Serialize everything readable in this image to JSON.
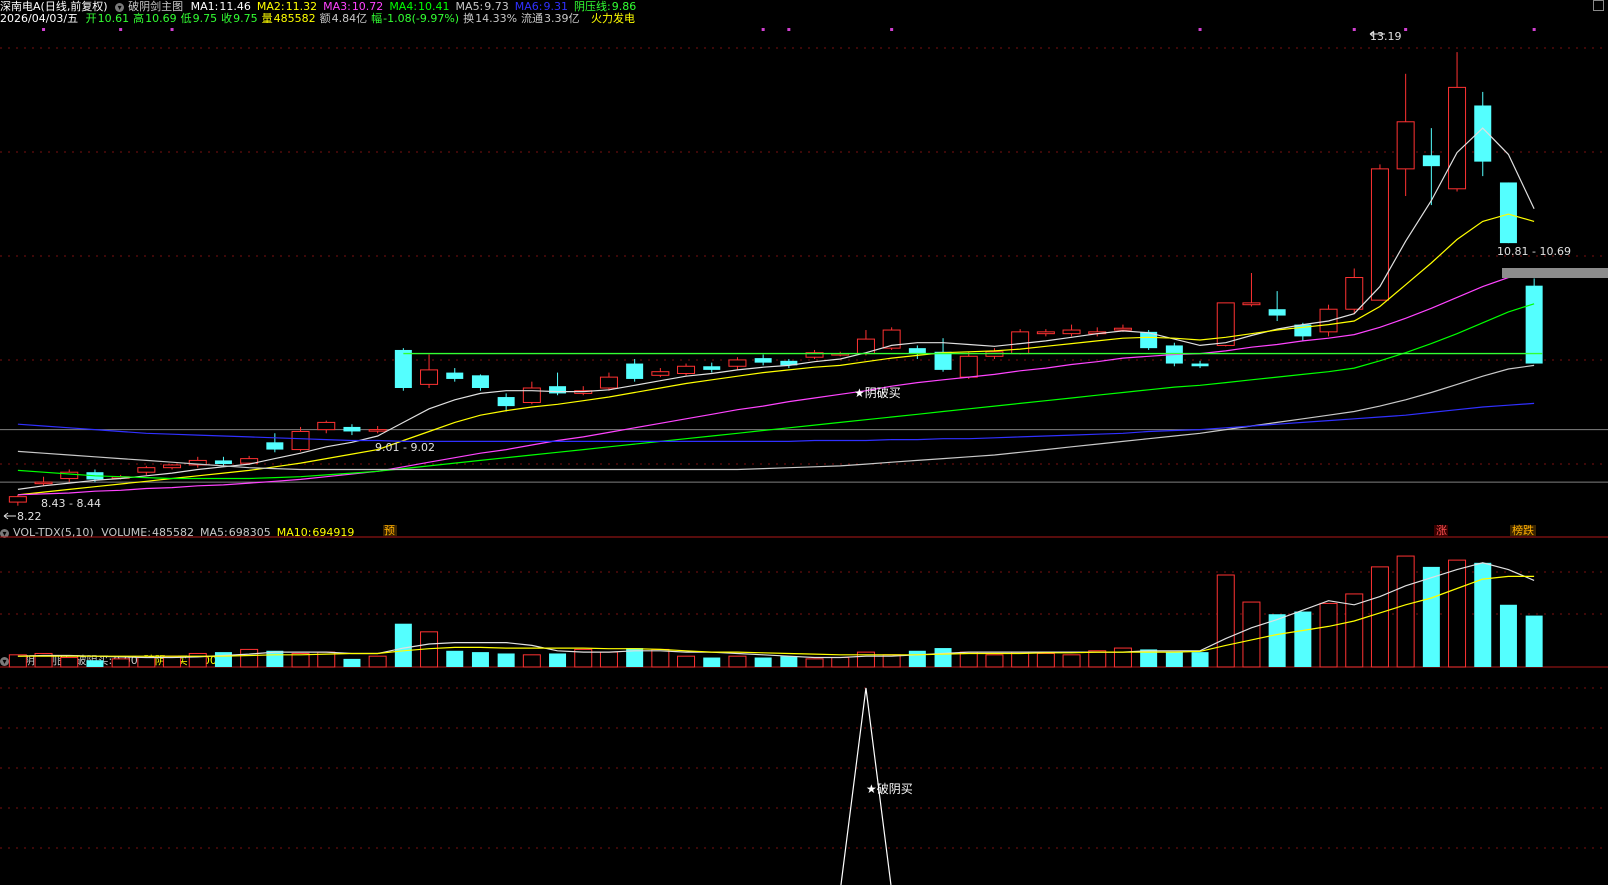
{
  "header": {
    "stock_name": "深南电A(日线,前复权)",
    "indicator_name": "破阴剑主图",
    "ma_labels": [
      {
        "label": "MA1:",
        "value": "11.46",
        "color": "#ffffff"
      },
      {
        "label": "MA2:",
        "value": "11.32",
        "color": "#ffff00"
      },
      {
        "label": "MA3:",
        "value": "10.72",
        "color": "#ff44ff"
      },
      {
        "label": "MA4:",
        "value": "10.41",
        "color": "#00ff00"
      },
      {
        "label": "MA5:",
        "value": "9.73",
        "color": "#c8c8c8"
      },
      {
        "label": "MA6:",
        "value": "9.31",
        "color": "#3030ff"
      },
      {
        "label": "阴压线:",
        "value": "9.86",
        "color": "#33ff33"
      }
    ],
    "date": "2026/04/03/五",
    "quote_items": [
      {
        "label": "开",
        "value": "10.61",
        "color": "#33ff33"
      },
      {
        "label": "高",
        "value": "10.69",
        "color": "#33ff33"
      },
      {
        "label": "低",
        "value": "9.75",
        "color": "#33ff33"
      },
      {
        "label": "收",
        "value": "9.75",
        "color": "#33ff33"
      },
      {
        "label": "量",
        "value": "485582",
        "color": "#ffff00"
      },
      {
        "label": "额",
        "value": "4.84亿",
        "color": "#c8c8c8"
      },
      {
        "label": "幅",
        "value": "-1.08(-9.97%)",
        "color": "#33ff33"
      },
      {
        "label": "换",
        "value": "14.33%",
        "color": "#c8c8c8"
      },
      {
        "label": "流通",
        "value": "3.39亿",
        "color": "#c8c8c8"
      }
    ],
    "sector": "火力发电"
  },
  "main_chart": {
    "type": "candlestick",
    "annotations": {
      "high_label": "13.19",
      "low_label": "8.22",
      "range1": "8.43 - 8.44",
      "range2": "9.01 - 9.02",
      "range3": "10.81 - 10.69",
      "signal": "★阴破买"
    },
    "bottom_markers": [
      {
        "text": "预",
        "color": "#ffb000"
      },
      {
        "text": "涨",
        "color": "#ff5050"
      },
      {
        "text": "榜跌",
        "color": "#ffb000"
      }
    ]
  },
  "volume_panel": {
    "title": "VOL-TDX(5,10)",
    "items": [
      {
        "label": "VOLUME:",
        "value": "485582",
        "color": "#c8c8c8"
      },
      {
        "label": "MA5:",
        "value": "698305",
        "color": "#c8c8c8"
      },
      {
        "label": "MA10:",
        "value": "694919",
        "color": "#ffff00"
      }
    ]
  },
  "sub_panel": {
    "title": "破阴剑副图",
    "items": [
      {
        "label": "破阴买:",
        "value": "0.00",
        "color": "#c8c8c8"
      },
      {
        "label": "破阴二买:",
        "value": "0.00",
        "color": "#ffff00"
      }
    ],
    "signal": "★破阴买"
  },
  "chart_data": {
    "type": "candlestick",
    "candles": [
      {
        "o": 8.22,
        "c": 8.28,
        "h": 8.3,
        "l": 8.18
      },
      {
        "o": 8.43,
        "c": 8.44,
        "h": 8.5,
        "l": 8.4
      },
      {
        "o": 8.48,
        "c": 8.55,
        "h": 8.58,
        "l": 8.44
      },
      {
        "o": 8.55,
        "c": 8.47,
        "h": 8.58,
        "l": 8.44
      },
      {
        "o": 8.5,
        "c": 8.5,
        "h": 8.52,
        "l": 8.47
      },
      {
        "o": 8.55,
        "c": 8.6,
        "h": 8.62,
        "l": 8.52
      },
      {
        "o": 8.6,
        "c": 8.63,
        "h": 8.64,
        "l": 8.58
      },
      {
        "o": 8.63,
        "c": 8.68,
        "h": 8.72,
        "l": 8.6
      },
      {
        "o": 8.68,
        "c": 8.64,
        "h": 8.72,
        "l": 8.62
      },
      {
        "o": 8.65,
        "c": 8.7,
        "h": 8.73,
        "l": 8.63
      },
      {
        "o": 8.88,
        "c": 8.8,
        "h": 8.98,
        "l": 8.77
      },
      {
        "o": 8.8,
        "c": 9.0,
        "h": 9.05,
        "l": 8.78
      },
      {
        "o": 9.02,
        "c": 9.1,
        "h": 9.12,
        "l": 8.98
      },
      {
        "o": 9.05,
        "c": 9.0,
        "h": 9.08,
        "l": 8.96
      },
      {
        "o": 9.01,
        "c": 9.02,
        "h": 9.06,
        "l": 8.98
      },
      {
        "o": 9.9,
        "c": 9.48,
        "h": 9.92,
        "l": 9.45
      },
      {
        "o": 9.52,
        "c": 9.68,
        "h": 9.85,
        "l": 9.48
      },
      {
        "o": 9.65,
        "c": 9.58,
        "h": 9.7,
        "l": 9.55
      },
      {
        "o": 9.62,
        "c": 9.48,
        "h": 9.63,
        "l": 9.45
      },
      {
        "o": 9.38,
        "c": 9.28,
        "h": 9.42,
        "l": 9.22
      },
      {
        "o": 9.32,
        "c": 9.48,
        "h": 9.55,
        "l": 9.3
      },
      {
        "o": 9.5,
        "c": 9.42,
        "h": 9.65,
        "l": 9.4
      },
      {
        "o": 9.42,
        "c": 9.45,
        "h": 9.5,
        "l": 9.4
      },
      {
        "o": 9.48,
        "c": 9.6,
        "h": 9.65,
        "l": 9.45
      },
      {
        "o": 9.75,
        "c": 9.58,
        "h": 9.8,
        "l": 9.55
      },
      {
        "o": 9.62,
        "c": 9.66,
        "h": 9.7,
        "l": 9.6
      },
      {
        "o": 9.64,
        "c": 9.72,
        "h": 9.75,
        "l": 9.62
      },
      {
        "o": 9.72,
        "c": 9.68,
        "h": 9.76,
        "l": 9.65
      },
      {
        "o": 9.72,
        "c": 9.79,
        "h": 9.82,
        "l": 9.68
      },
      {
        "o": 9.81,
        "c": 9.76,
        "h": 9.85,
        "l": 9.73
      },
      {
        "o": 9.78,
        "c": 9.73,
        "h": 9.8,
        "l": 9.7
      },
      {
        "o": 9.82,
        "c": 9.87,
        "h": 9.9,
        "l": 9.8
      },
      {
        "o": 9.85,
        "c": 9.86,
        "h": 9.88,
        "l": 9.83
      },
      {
        "o": 9.86,
        "c": 10.02,
        "h": 10.12,
        "l": 9.84
      },
      {
        "o": 9.92,
        "c": 10.12,
        "h": 10.15,
        "l": 9.9
      },
      {
        "o": 9.92,
        "c": 9.86,
        "h": 9.95,
        "l": 9.8
      },
      {
        "o": 9.88,
        "c": 9.68,
        "h": 10.03,
        "l": 9.66
      },
      {
        "o": 9.6,
        "c": 9.83,
        "h": 9.88,
        "l": 9.58
      },
      {
        "o": 9.83,
        "c": 9.88,
        "h": 9.92,
        "l": 9.8
      },
      {
        "o": 9.86,
        "c": 10.1,
        "h": 10.13,
        "l": 9.85
      },
      {
        "o": 10.08,
        "c": 10.1,
        "h": 10.13,
        "l": 10.05
      },
      {
        "o": 10.08,
        "c": 10.12,
        "h": 10.18,
        "l": 10.05
      },
      {
        "o": 10.08,
        "c": 10.1,
        "h": 10.15,
        "l": 10.05
      },
      {
        "o": 10.12,
        "c": 10.14,
        "h": 10.18,
        "l": 10.1
      },
      {
        "o": 10.1,
        "c": 9.92,
        "h": 10.12,
        "l": 9.9
      },
      {
        "o": 9.95,
        "c": 9.75,
        "h": 9.98,
        "l": 9.72
      },
      {
        "o": 9.75,
        "c": 9.72,
        "h": 9.78,
        "l": 9.7
      },
      {
        "o": 9.95,
        "c": 10.42,
        "h": 10.42,
        "l": 9.94
      },
      {
        "o": 10.4,
        "c": 10.42,
        "h": 10.75,
        "l": 10.38
      },
      {
        "o": 10.35,
        "c": 10.28,
        "h": 10.55,
        "l": 10.22
      },
      {
        "o": 10.18,
        "c": 10.05,
        "h": 10.2,
        "l": 10.0
      },
      {
        "o": 10.1,
        "c": 10.35,
        "h": 10.4,
        "l": 10.05
      },
      {
        "o": 10.35,
        "c": 10.7,
        "h": 10.8,
        "l": 10.3
      },
      {
        "o": 10.45,
        "c": 11.9,
        "h": 11.95,
        "l": 10.45
      },
      {
        "o": 11.9,
        "c": 12.42,
        "h": 12.95,
        "l": 11.6
      },
      {
        "o": 12.05,
        "c": 11.93,
        "h": 12.35,
        "l": 11.5
      },
      {
        "o": 11.68,
        "c": 12.8,
        "h": 13.19,
        "l": 11.65
      },
      {
        "o": 12.6,
        "c": 11.98,
        "h": 12.75,
        "l": 11.82
      },
      {
        "o": 11.75,
        "c": 11.08,
        "h": 11.75,
        "l": 11.08
      },
      {
        "o": 10.61,
        "c": 9.75,
        "h": 10.69,
        "l": 9.75
      }
    ],
    "yin_pressure_line": 9.86,
    "price_range": [
      8.0,
      13.5
    ],
    "volume": [
      0.9,
      1.0,
      0.7,
      0.5,
      0.6,
      0.7,
      0.8,
      1.0,
      1.1,
      1.3,
      1.2,
      1.0,
      1.1,
      0.6,
      0.8,
      3.2,
      2.6,
      1.2,
      1.1,
      1.0,
      0.9,
      1.0,
      1.3,
      1.1,
      1.4,
      1.3,
      0.8,
      0.7,
      0.8,
      0.7,
      0.8,
      0.6,
      0.7,
      1.1,
      0.9,
      1.2,
      1.4,
      1.1,
      0.9,
      1.1,
      1.0,
      0.9,
      1.2,
      1.4,
      1.3,
      1.1,
      1.1,
      6.8,
      4.8,
      3.9,
      4.1,
      4.7,
      5.4,
      7.4,
      8.2,
      7.4,
      7.9,
      7.7,
      4.6,
      3.8
    ],
    "volume_range": [
      0,
      8.5
    ],
    "ma_lines": [
      {
        "name": "MA1",
        "color": "#e0e0e0",
        "values": [
          8.36,
          8.4,
          8.43,
          8.46,
          8.48,
          8.51,
          8.54,
          8.58,
          8.61,
          8.64,
          8.7,
          8.76,
          8.83,
          8.88,
          8.95,
          9.1,
          9.25,
          9.35,
          9.42,
          9.45,
          9.45,
          9.44,
          9.44,
          9.46,
          9.51,
          9.56,
          9.61,
          9.64,
          9.68,
          9.71,
          9.73,
          9.77,
          9.8,
          9.87,
          9.95,
          9.98,
          9.98,
          9.96,
          9.94,
          9.97,
          10.0,
          10.04,
          10.08,
          10.11,
          10.09,
          10.02,
          9.95,
          9.98,
          10.06,
          10.13,
          10.18,
          10.22,
          10.3,
          10.6,
          11.1,
          11.55,
          12.08,
          12.35,
          12.06,
          11.46
        ]
      },
      {
        "name": "MA2",
        "color": "#ffff00",
        "values": [
          8.3,
          8.33,
          8.36,
          8.39,
          8.42,
          8.45,
          8.48,
          8.51,
          8.54,
          8.57,
          8.61,
          8.65,
          8.7,
          8.75,
          8.8,
          8.9,
          9.0,
          9.1,
          9.18,
          9.23,
          9.27,
          9.3,
          9.34,
          9.38,
          9.43,
          9.48,
          9.53,
          9.57,
          9.61,
          9.65,
          9.68,
          9.71,
          9.73,
          9.77,
          9.81,
          9.84,
          9.87,
          9.88,
          9.89,
          9.91,
          9.94,
          9.97,
          10.0,
          10.03,
          10.04,
          10.03,
          10.01,
          10.04,
          10.08,
          10.12,
          10.15,
          10.18,
          10.22,
          10.38,
          10.62,
          10.86,
          11.12,
          11.32,
          11.4,
          11.32
        ]
      },
      {
        "name": "MA3",
        "color": "#ff44ff",
        "values": [
          8.3,
          8.31,
          8.32,
          8.34,
          8.35,
          8.37,
          8.38,
          8.4,
          8.41,
          8.43,
          8.45,
          8.47,
          8.5,
          8.53,
          8.56,
          8.61,
          8.66,
          8.71,
          8.76,
          8.8,
          8.85,
          8.9,
          8.94,
          8.99,
          9.04,
          9.09,
          9.14,
          9.19,
          9.24,
          9.28,
          9.33,
          9.37,
          9.41,
          9.45,
          9.5,
          9.54,
          9.57,
          9.6,
          9.63,
          9.67,
          9.7,
          9.74,
          9.77,
          9.81,
          9.83,
          9.85,
          9.86,
          9.89,
          9.93,
          9.96,
          10.0,
          10.03,
          10.07,
          10.15,
          10.25,
          10.36,
          10.48,
          10.6,
          10.7,
          10.72
        ]
      },
      {
        "name": "MA4",
        "color": "#00ff00",
        "values": [
          8.57,
          8.55,
          8.53,
          8.51,
          8.5,
          8.49,
          8.48,
          8.48,
          8.48,
          8.48,
          8.49,
          8.5,
          8.52,
          8.54,
          8.56,
          8.59,
          8.62,
          8.65,
          8.68,
          8.71,
          8.74,
          8.77,
          8.8,
          8.83,
          8.86,
          8.89,
          8.92,
          8.95,
          8.98,
          9.01,
          9.04,
          9.07,
          9.1,
          9.13,
          9.16,
          9.19,
          9.22,
          9.25,
          9.28,
          9.31,
          9.34,
          9.37,
          9.4,
          9.43,
          9.46,
          9.49,
          9.51,
          9.54,
          9.57,
          9.6,
          9.63,
          9.66,
          9.7,
          9.78,
          9.87,
          9.97,
          10.08,
          10.2,
          10.32,
          10.41
        ]
      },
      {
        "name": "MA5",
        "color": "#c8c8c8",
        "values": [
          8.78,
          8.76,
          8.74,
          8.72,
          8.7,
          8.68,
          8.66,
          8.64,
          8.62,
          8.6,
          8.59,
          8.58,
          8.58,
          8.58,
          8.58,
          8.58,
          8.58,
          8.58,
          8.58,
          8.58,
          8.58,
          8.58,
          8.58,
          8.58,
          8.58,
          8.58,
          8.58,
          8.58,
          8.58,
          8.59,
          8.6,
          8.61,
          8.62,
          8.64,
          8.66,
          8.68,
          8.7,
          8.72,
          8.74,
          8.77,
          8.8,
          8.83,
          8.86,
          8.89,
          8.92,
          8.95,
          8.98,
          9.02,
          9.06,
          9.1,
          9.14,
          9.18,
          9.22,
          9.28,
          9.35,
          9.43,
          9.52,
          9.61,
          9.69,
          9.73
        ]
      },
      {
        "name": "MA6",
        "color": "#3030ff",
        "values": [
          9.08,
          9.06,
          9.04,
          9.02,
          9.0,
          8.98,
          8.97,
          8.96,
          8.95,
          8.94,
          8.93,
          8.92,
          8.91,
          8.9,
          8.9,
          8.89,
          8.89,
          8.89,
          8.89,
          8.89,
          8.89,
          8.89,
          8.89,
          8.89,
          8.89,
          8.89,
          8.89,
          8.89,
          8.89,
          8.89,
          8.89,
          8.9,
          8.9,
          8.9,
          8.91,
          8.91,
          8.92,
          8.92,
          8.93,
          8.94,
          8.95,
          8.96,
          8.97,
          8.98,
          9.0,
          9.01,
          9.02,
          9.04,
          9.06,
          9.08,
          9.1,
          9.12,
          9.14,
          9.16,
          9.18,
          9.21,
          9.24,
          9.27,
          9.29,
          9.31
        ]
      }
    ],
    "volume_ma": [
      {
        "name": "MA5",
        "color": "#e0e0e0",
        "values": [
          0.8,
          0.85,
          0.85,
          0.8,
          0.75,
          0.7,
          0.7,
          0.75,
          0.85,
          0.95,
          1.1,
          1.1,
          1.1,
          1.0,
          1.0,
          1.4,
          1.7,
          1.8,
          1.8,
          1.8,
          1.6,
          1.2,
          1.1,
          1.1,
          1.2,
          1.2,
          1.1,
          1.1,
          1.0,
          0.9,
          0.8,
          0.7,
          0.7,
          0.8,
          0.8,
          0.9,
          1.0,
          1.1,
          1.1,
          1.1,
          1.1,
          1.1,
          1.1,
          1.1,
          1.2,
          1.2,
          1.2,
          2.1,
          2.9,
          3.5,
          4.2,
          4.9,
          4.6,
          5.2,
          6.0,
          6.6,
          7.2,
          7.7,
          7.2,
          6.4
        ]
      },
      {
        "name": "MA10",
        "color": "#ffff00",
        "values": [
          0.8,
          0.8,
          0.8,
          0.8,
          0.8,
          0.8,
          0.8,
          0.8,
          0.8,
          0.85,
          0.9,
          0.9,
          0.95,
          1.0,
          1.0,
          1.2,
          1.35,
          1.45,
          1.45,
          1.4,
          1.4,
          1.4,
          1.4,
          1.35,
          1.35,
          1.3,
          1.2,
          1.1,
          1.1,
          1.05,
          1.0,
          0.95,
          0.9,
          0.9,
          0.9,
          0.9,
          0.95,
          1.0,
          1.0,
          1.0,
          1.05,
          1.05,
          1.1,
          1.1,
          1.1,
          1.1,
          1.15,
          1.6,
          2.0,
          2.4,
          2.7,
          3.0,
          3.4,
          4.0,
          4.6,
          5.1,
          5.8,
          6.5,
          6.7,
          6.7
        ]
      }
    ],
    "sub_signal": [
      0,
      0,
      0,
      0,
      0,
      0,
      0,
      0,
      0,
      0,
      0,
      0,
      0,
      0,
      0,
      0,
      0,
      0,
      0,
      0,
      0,
      0,
      0,
      0,
      0,
      0,
      0,
      0,
      0,
      0,
      0,
      0,
      0,
      1,
      0,
      0,
      0,
      0,
      0,
      0,
      0,
      0,
      0,
      0,
      0,
      0,
      0,
      0,
      0,
      0,
      0,
      0,
      0,
      0,
      0,
      0,
      0,
      0,
      0,
      0
    ],
    "colors": {
      "up": "#ff3232",
      "down": "#54ffff",
      "grid": "#7a1010",
      "divider": "#b01818",
      "pressure_line": "#33ff33"
    }
  }
}
